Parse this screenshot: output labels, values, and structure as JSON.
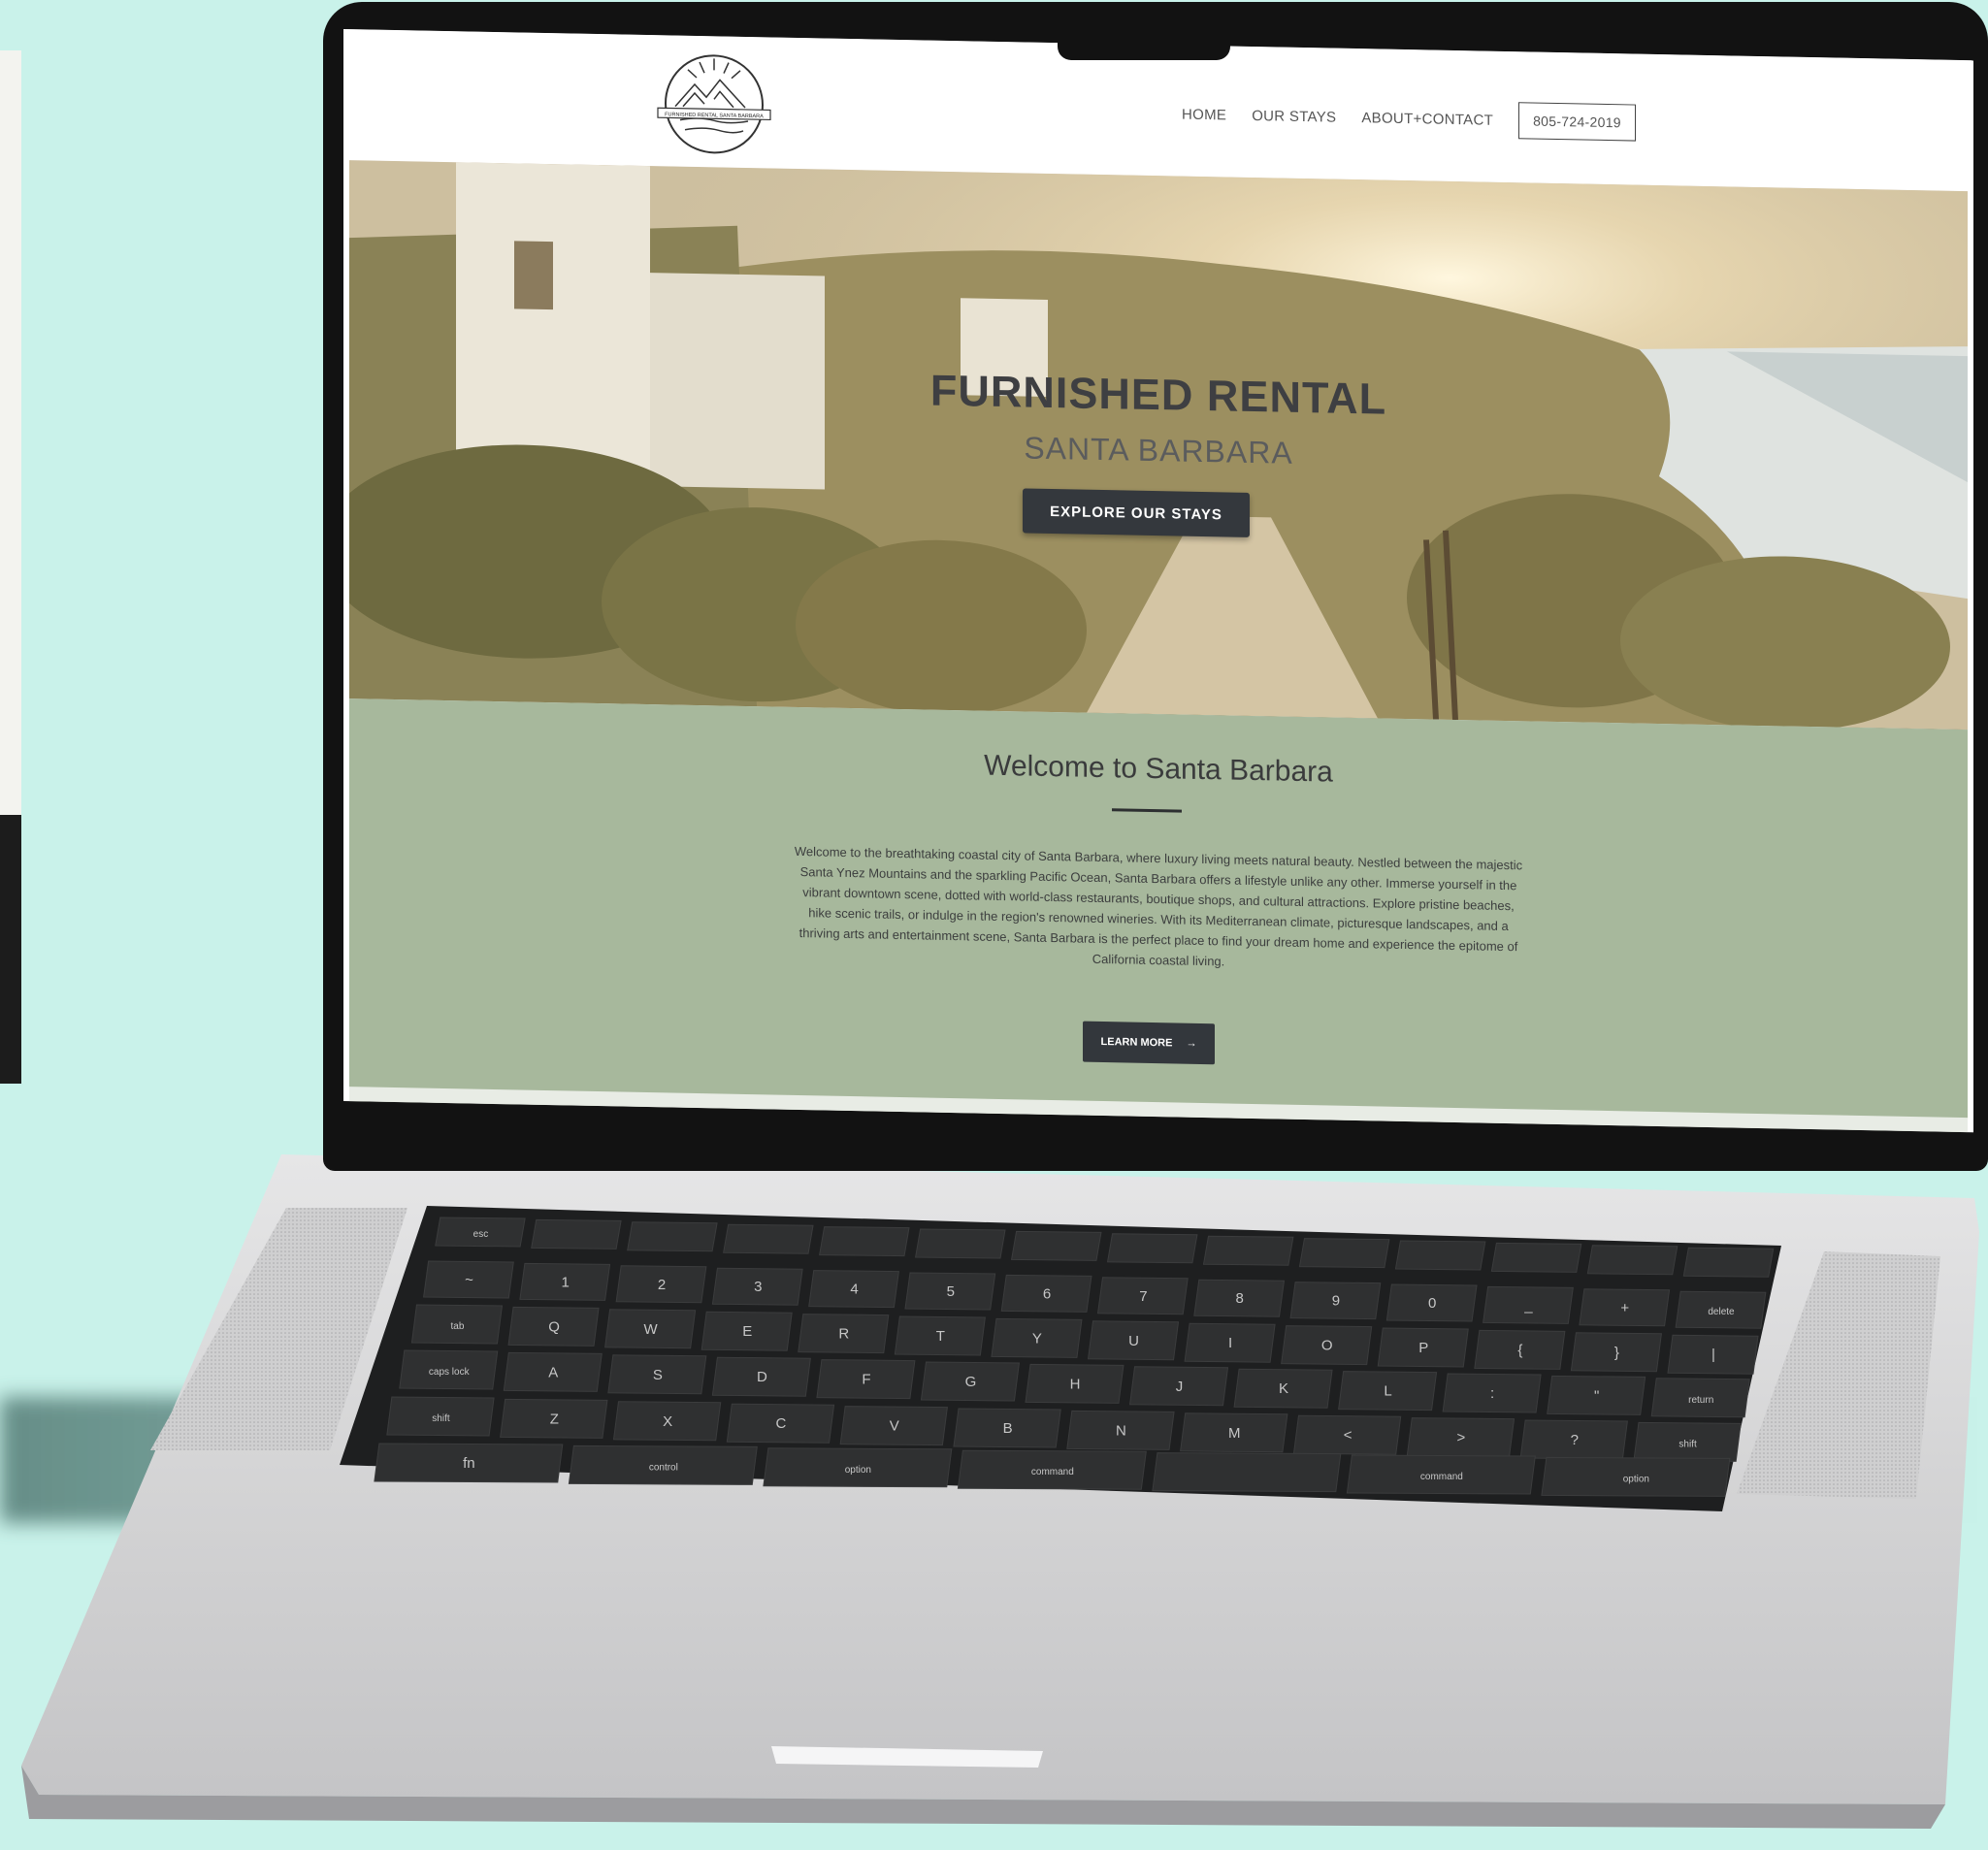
{
  "site": {
    "logo_text": "FURNISHED RENTAL SANTA BARBARA",
    "nav": [
      "HOME",
      "OUR STAYS",
      "ABOUT+CONTACT"
    ],
    "phone": "805-724-2019"
  },
  "hero": {
    "title": "FURNISHED RENTAL",
    "subtitle": "SANTA BARBARA",
    "button": "EXPLORE OUR STAYS"
  },
  "welcome": {
    "title": "Welcome to Santa Barbara",
    "body": "Welcome to the breathtaking coastal city of Santa Barbara, where luxury living meets natural beauty. Nestled between the majestic Santa Ynez Mountains and the sparkling Pacific Ocean, Santa Barbara offers a lifestyle unlike any other. Immerse yourself in the vibrant downtown scene, dotted with world-class restaurants, boutique shops, and cultural attractions. Explore pristine beaches, hike scenic trails, or indulge in the region's renowned wineries. With its Mediterranean climate, picturesque landscapes, and a thriving arts and entertainment scene, Santa Barbara is the perfect place to find your dream home and experience the epitome of California coastal living.",
    "button": "LEARN MORE",
    "button_icon": "arrow-right-icon"
  },
  "keyboard": {
    "fn_row": [
      "esc",
      "",
      "",
      "",
      "",
      "",
      "",
      "",
      "",
      "",
      "",
      "",
      "",
      ""
    ],
    "num_row": [
      "~",
      "1",
      "2",
      "3",
      "4",
      "5",
      "6",
      "7",
      "8",
      "9",
      "0",
      "_",
      "+",
      "delete"
    ],
    "top_row": [
      "tab",
      "Q",
      "W",
      "E",
      "R",
      "T",
      "Y",
      "U",
      "I",
      "O",
      "P",
      "{",
      "}",
      "|"
    ],
    "home_row": [
      "caps lock",
      "A",
      "S",
      "D",
      "F",
      "G",
      "H",
      "J",
      "K",
      "L",
      ":",
      "\"",
      "return"
    ],
    "bottom_row": [
      "shift",
      "Z",
      "X",
      "C",
      "V",
      "B",
      "N",
      "M",
      "<",
      ">",
      "?",
      "shift"
    ],
    "mod_row": [
      "fn",
      "control",
      "option",
      "command",
      "",
      "command",
      "option"
    ]
  },
  "colors": {
    "background": "#c9f2ea",
    "sage": "#a7b89c",
    "button": "#34383d",
    "keyboard": "#2a2b2c",
    "laptop": "#d9d9da"
  }
}
